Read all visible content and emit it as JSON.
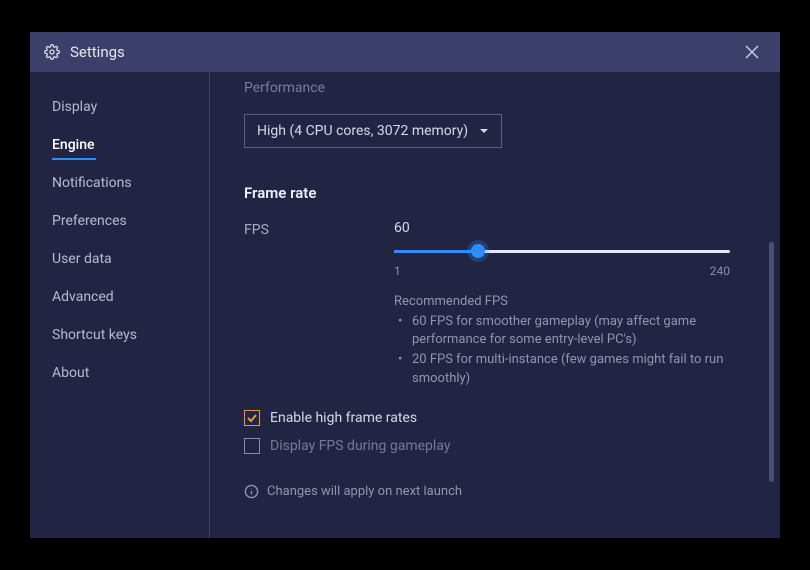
{
  "window": {
    "title": "Settings"
  },
  "sidebar": {
    "items": [
      {
        "label": "Display"
      },
      {
        "label": "Engine"
      },
      {
        "label": "Notifications"
      },
      {
        "label": "Preferences"
      },
      {
        "label": "User data"
      },
      {
        "label": "Advanced"
      },
      {
        "label": "Shortcut keys"
      },
      {
        "label": "About"
      }
    ]
  },
  "content": {
    "performance_heading": "Performance",
    "performance_value": "High (4 CPU cores, 3072 memory)",
    "frame_heading": "Frame rate",
    "fps_label": "FPS",
    "fps_value": "60",
    "fps_min": "1",
    "fps_max": "240",
    "recommend_title": "Recommended FPS",
    "recommend_items": [
      "60 FPS for smoother gameplay (may affect game performance for some entry-level PC's)",
      "20 FPS for multi-instance (few games might fail to run smoothly)"
    ],
    "check_high_fps": "Enable high frame rates",
    "check_display_fps": "Display FPS during gameplay",
    "info_text": "Changes will apply on next launch"
  }
}
